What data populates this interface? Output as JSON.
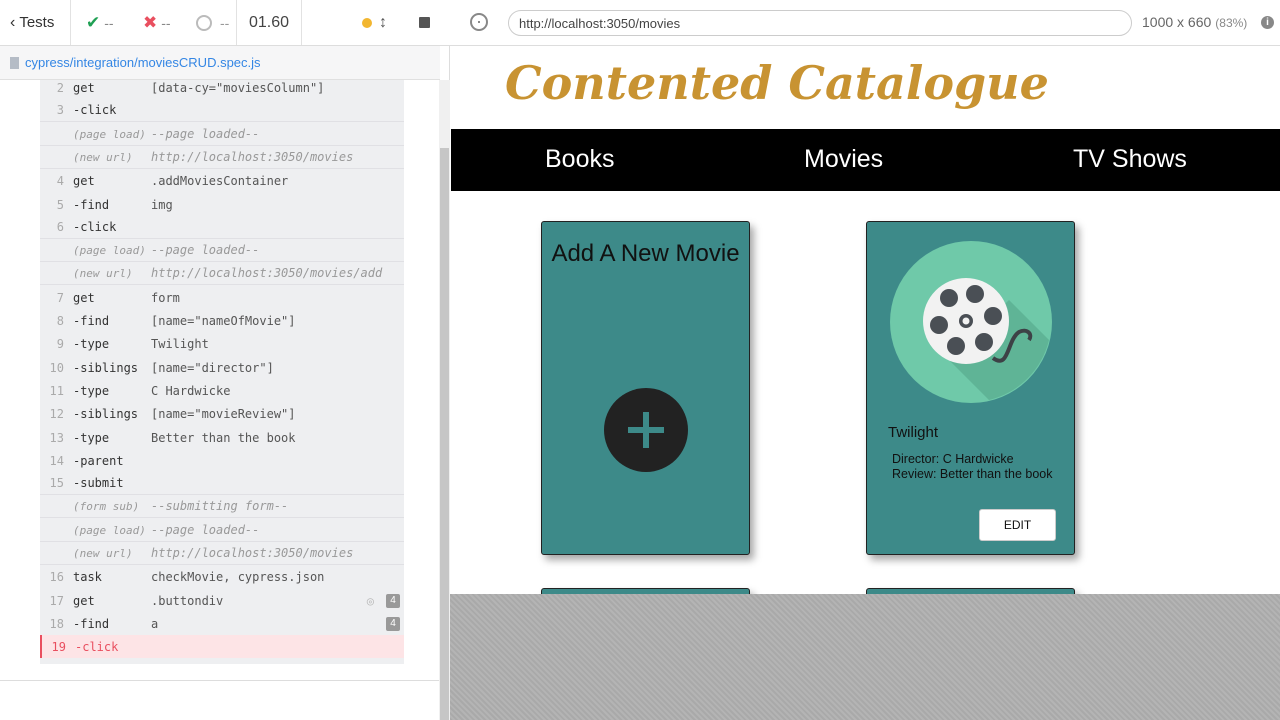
{
  "runner": {
    "tests_label": "Tests",
    "passed": "--",
    "failed": "--",
    "pending": "--",
    "duration": "01.60",
    "spec_file": "cypress/integration/moviesCRUD.spec.js"
  },
  "commands": [
    {
      "num": "2",
      "name": "get",
      "msg": "[data-cy=\"moviesColumn\"]"
    },
    {
      "num": "3",
      "name": "-click",
      "msg": ""
    },
    {
      "num": "",
      "name": "(page load)",
      "msg": "--page loaded--"
    },
    {
      "num": "",
      "name": "(new url)",
      "msg": "http://localhost:3050/movies"
    },
    {
      "num": "4",
      "name": "get",
      "msg": ".addMoviesContainer"
    },
    {
      "num": "5",
      "name": "-find",
      "msg": "img"
    },
    {
      "num": "6",
      "name": "-click",
      "msg": ""
    },
    {
      "num": "",
      "name": "(page load)",
      "msg": "--page loaded--"
    },
    {
      "num": "",
      "name": "(new url)",
      "msg": "http://localhost:3050/movies/add"
    },
    {
      "num": "7",
      "name": "get",
      "msg": "form"
    },
    {
      "num": "8",
      "name": "-find",
      "msg": "[name=\"nameOfMovie\"]"
    },
    {
      "num": "9",
      "name": "-type",
      "msg": "Twilight"
    },
    {
      "num": "10",
      "name": "-siblings",
      "msg": "[name=\"director\"]"
    },
    {
      "num": "11",
      "name": "-type",
      "msg": "C Hardwicke"
    },
    {
      "num": "12",
      "name": "-siblings",
      "msg": "[name=\"movieReview\"]"
    },
    {
      "num": "13",
      "name": "-type",
      "msg": "Better than the book"
    },
    {
      "num": "14",
      "name": "-parent",
      "msg": ""
    },
    {
      "num": "15",
      "name": "-submit",
      "msg": ""
    },
    {
      "num": "",
      "name": "(form sub)",
      "msg": "--submitting form--"
    },
    {
      "num": "",
      "name": "(page load)",
      "msg": "--page loaded--"
    },
    {
      "num": "",
      "name": "(new url)",
      "msg": "http://localhost:3050/movies"
    },
    {
      "num": "16",
      "name": "task",
      "msg": "checkMovie, cypress.json"
    },
    {
      "num": "17",
      "name": "get",
      "msg": ".buttondiv",
      "badge": "4",
      "eye": true
    },
    {
      "num": "18",
      "name": "-find",
      "msg": "a",
      "badge": "4"
    },
    {
      "num": "19",
      "name": "-click",
      "msg": "",
      "failed": true
    }
  ],
  "aut": {
    "url": "http://localhost:3050/movies",
    "viewport": "1000 x 660",
    "scale": "(83%)"
  },
  "app": {
    "logo": "Contented Catalogue",
    "nav": [
      "Books",
      "Movies",
      "TV Shows"
    ],
    "add_card_title": "Add A New Movie",
    "movie": {
      "title": "Twilight",
      "director": "Director: C Hardwicke",
      "review": "Review: Better than the book",
      "edit_label": "EDIT"
    }
  },
  "colors": {
    "card_teal": "#3d8a89",
    "logo_gold": "#c89332",
    "pass_green": "#20a054",
    "fail_red": "#e94f5f"
  }
}
